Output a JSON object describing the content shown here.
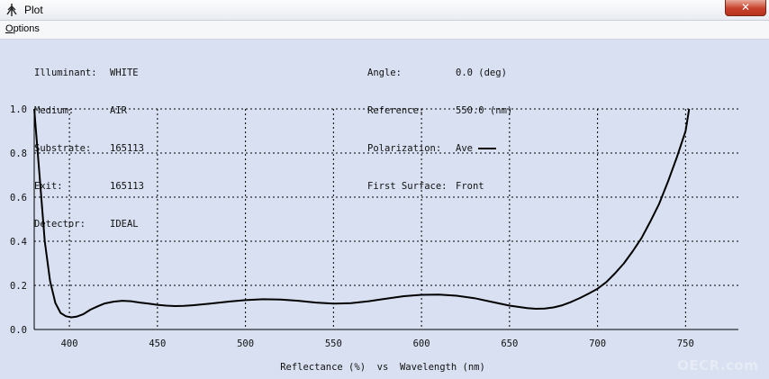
{
  "window": {
    "title": "Plot",
    "close_label": "✕"
  },
  "menu": {
    "options_label": "Options"
  },
  "info_left": [
    {
      "label": "Illuminant:",
      "value": "WHITE"
    },
    {
      "label": "Medium:",
      "value": "AIR"
    },
    {
      "label": "Substrate:",
      "value": "165113"
    },
    {
      "label": "Exit:",
      "value": "165113"
    },
    {
      "label": "Detector:",
      "value": "IDEAL"
    }
  ],
  "info_right": [
    {
      "label": "Angle:",
      "value": "0.0 (deg)"
    },
    {
      "label": "Reference:",
      "value": "550.0 (nm)"
    },
    {
      "label": "Polarization:",
      "value": "Ave"
    },
    {
      "label": "First Surface:",
      "value": "Front"
    }
  ],
  "watermark": "OECR.com",
  "colors": {
    "background": "#d8e0f1",
    "curve": "#000000",
    "grid": "#000000",
    "close_button": "#c7402b"
  },
  "chart_data": {
    "type": "line",
    "title": "",
    "xlabel": "Reflectance (%)  vs  Wavelength (nm)",
    "ylabel": "",
    "xlim": [
      380,
      780
    ],
    "ylim": [
      0.0,
      1.0
    ],
    "xticks": [
      400,
      450,
      500,
      550,
      600,
      650,
      700,
      750
    ],
    "yticks": [
      0.0,
      0.2,
      0.4,
      0.6,
      0.8,
      1.0
    ],
    "ytick_labels": [
      "0.0",
      "0.2",
      "0.4",
      "0.6",
      "0.8",
      "1.0"
    ],
    "grid": true,
    "grid_style": "dashed",
    "series": [
      {
        "x": [
          380,
          383,
          386,
          389,
          392,
          395,
          398,
          401,
          404,
          408,
          412,
          416,
          420,
          425,
          430,
          435,
          440,
          445,
          450,
          455,
          460,
          465,
          470,
          480,
          490,
          500,
          510,
          520,
          530,
          540,
          550,
          560,
          570,
          580,
          590,
          600,
          610,
          620,
          630,
          640,
          650,
          660,
          665,
          670,
          675,
          680,
          685,
          690,
          695,
          700,
          705,
          710,
          715,
          720,
          725,
          730,
          735,
          740,
          745,
          750,
          752
        ],
        "y": [
          1.0,
          0.7,
          0.4,
          0.22,
          0.12,
          0.075,
          0.06,
          0.055,
          0.058,
          0.07,
          0.09,
          0.105,
          0.118,
          0.126,
          0.13,
          0.128,
          0.122,
          0.117,
          0.112,
          0.108,
          0.106,
          0.107,
          0.11,
          0.117,
          0.126,
          0.133,
          0.137,
          0.136,
          0.13,
          0.122,
          0.117,
          0.119,
          0.128,
          0.14,
          0.151,
          0.157,
          0.158,
          0.153,
          0.142,
          0.125,
          0.108,
          0.097,
          0.094,
          0.095,
          0.1,
          0.11,
          0.125,
          0.143,
          0.163,
          0.185,
          0.215,
          0.255,
          0.3,
          0.355,
          0.415,
          0.49,
          0.57,
          0.67,
          0.78,
          0.9,
          1.0
        ]
      }
    ]
  }
}
